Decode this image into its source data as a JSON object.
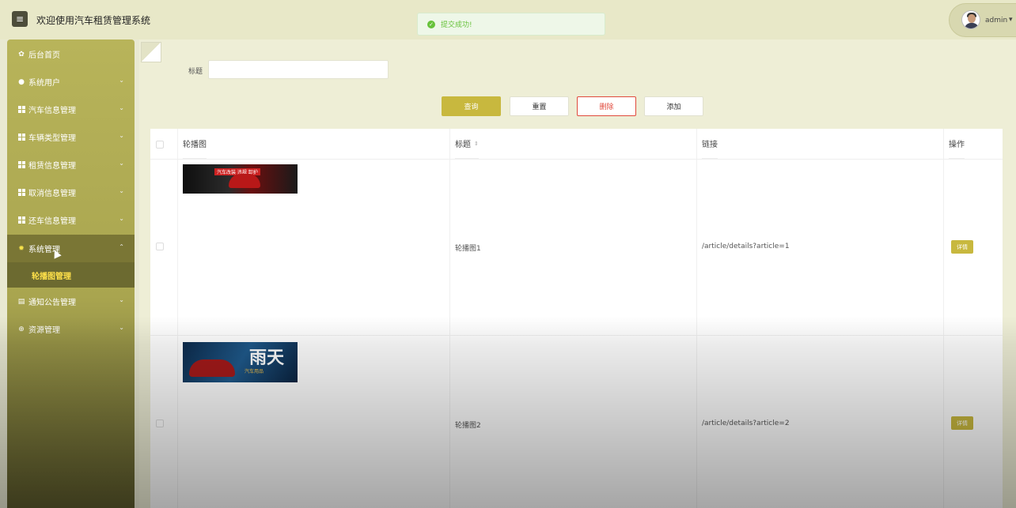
{
  "header": {
    "title": "欢迎使用汽车租赁管理系统",
    "menu_icon": "hamburger-icon",
    "user_name": "admin",
    "user_caret": "▾"
  },
  "toast": {
    "message": "提交成功!",
    "icon": "check-circle-icon",
    "color": "#67c23a"
  },
  "sidebar": {
    "items": [
      {
        "label": "后台首页",
        "icon": "gear-icon"
      },
      {
        "label": "系统用户",
        "icon": "user-icon"
      },
      {
        "label": "汽车信息管理",
        "icon": "grid-icon"
      },
      {
        "label": "车辆类型管理",
        "icon": "grid-icon"
      },
      {
        "label": "租赁信息管理",
        "icon": "grid-icon"
      },
      {
        "label": "取消信息管理",
        "icon": "grid-icon"
      },
      {
        "label": "还车信息管理",
        "icon": "grid-icon"
      },
      {
        "label": "系统管理",
        "icon": "gear-circle-icon",
        "expanded": true
      },
      {
        "label": "通知公告管理",
        "icon": "document-icon"
      },
      {
        "label": "资源管理",
        "icon": "plus-circle-icon"
      }
    ],
    "sub_item": "轮播图管理",
    "accent": "#ffe14a"
  },
  "search": {
    "label": "标题",
    "value": ""
  },
  "buttons": {
    "query": "查询",
    "reset": "重置",
    "delete": "删除",
    "add": "添加"
  },
  "table": {
    "headers": [
      "轮播图",
      "标题",
      "链接",
      "操作"
    ],
    "rows": [
      {
        "title": "轮播图1",
        "link": "/article/details?article=1",
        "action": "详情",
        "banner_text": "汽车改装 违规 卸护"
      },
      {
        "title": "轮播图2",
        "link": "/article/details?article=2",
        "action": "详情",
        "banner_big": "雨天",
        "banner_small": "汽车用品"
      }
    ]
  },
  "colors": {
    "primary": "#c8b83e",
    "danger": "#e04a3c",
    "sidebar": "#b8b45a"
  }
}
